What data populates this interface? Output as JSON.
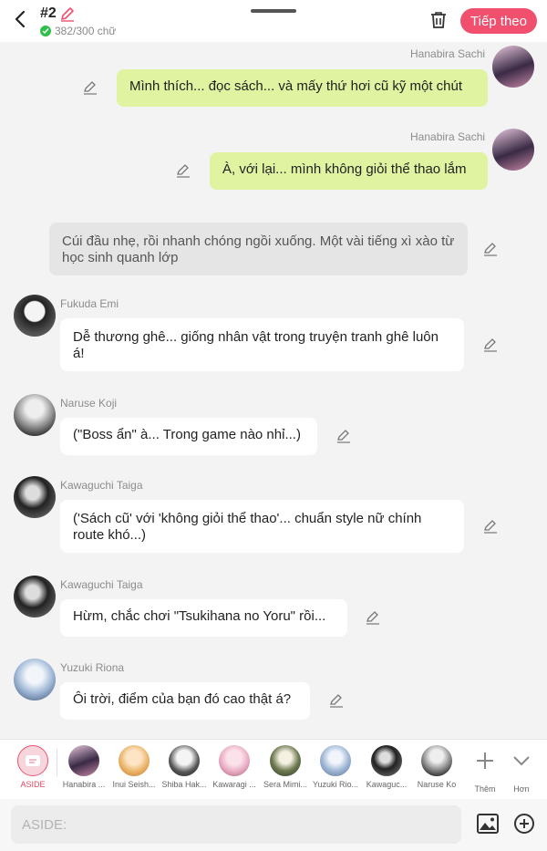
{
  "header": {
    "scene_number": "#2",
    "char_count": "382/300 chữ",
    "next_label": "Tiếp theo"
  },
  "messages": [
    {
      "type": "me",
      "name": "Hanabira Sachi",
      "text": "Mình thích... đọc sách... và mấy thứ hơi cũ kỹ một chút"
    },
    {
      "type": "me",
      "name": "Hanabira Sachi",
      "text": "À, với lại... mình không giỏi thể thao lắm"
    },
    {
      "type": "narration",
      "text": "Cúi đầu nhẹ, rồi nhanh chóng ngồi xuống. Một vài tiếng xì xào từ học sinh quanh lớp"
    },
    {
      "type": "other",
      "name": "Fukuda Emi",
      "text": "Dễ thương ghê... giống nhân vật trong truyện tranh ghê luôn á!"
    },
    {
      "type": "other",
      "name": "Naruse Koji",
      "text": "(\"Boss ẩn\" à... Trong game nào nhỉ...)"
    },
    {
      "type": "other",
      "name": "Kawaguchi Taiga",
      "text": "('Sách cũ' với 'không giỏi thể thao'... chuẩn style nữ chính route khó...)"
    },
    {
      "type": "other",
      "name": "Kawaguchi Taiga",
      "text": "Hừm, chắc chơi \"Tsukihana no Yoru\" rồi..."
    },
    {
      "type": "other",
      "name": "Yuzuki Riona",
      "text": "Ôi trời, điểm của bạn đó cao thật á?"
    }
  ],
  "characters": {
    "aside_label": "ASIDE",
    "items": [
      "Hanabira ...",
      "Inui Seish...",
      "Shiba Hak...",
      "Kawaragi ...",
      "Sera Mimi...",
      "Yuzuki Rio...",
      "Kawaguc...",
      "Naruse Ko"
    ],
    "add_label": "Thêm",
    "more_label": "Hơn"
  },
  "input": {
    "placeholder": "ASIDE:"
  },
  "colors": {
    "accent": "#f0506e",
    "my_bubble": "#dff3a0",
    "other_bubble": "#ffffff",
    "narration_bubble": "#e5e5e5"
  }
}
